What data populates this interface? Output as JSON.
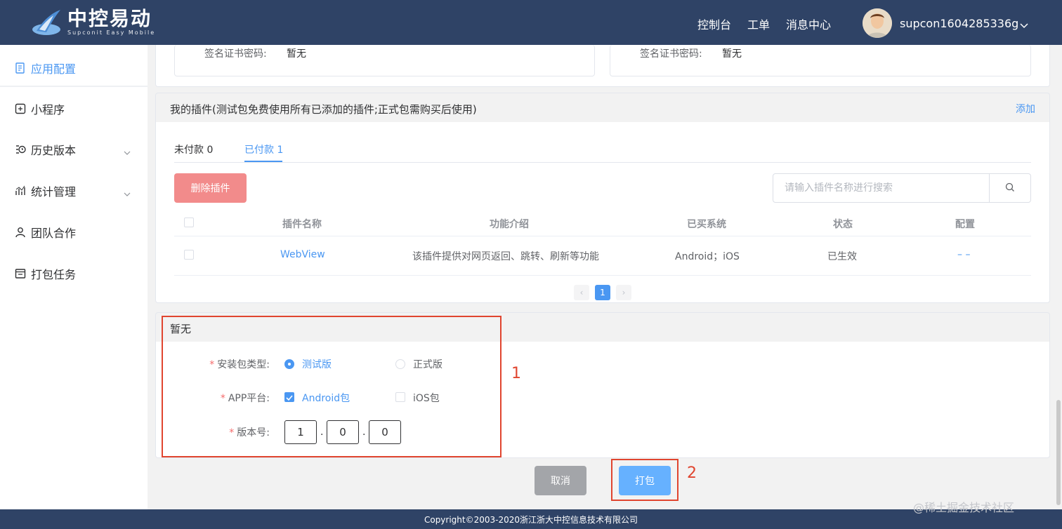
{
  "header": {
    "brand": "中控易动",
    "brand_sub": "Supconit Easy Mobile",
    "nav": [
      "控制台",
      "工单",
      "消息中心"
    ],
    "username": "supcon1604285336g"
  },
  "sidebar": {
    "items": [
      {
        "label": "应用配置",
        "icon": "app-config-icon"
      },
      {
        "label": "小程序",
        "icon": "miniprogram-icon"
      },
      {
        "label": "历史版本",
        "icon": "history-icon"
      },
      {
        "label": "统计管理",
        "icon": "stats-icon"
      },
      {
        "label": "团队合作",
        "icon": "team-icon"
      },
      {
        "label": "打包任务",
        "icon": "task-icon"
      }
    ]
  },
  "signature": {
    "left_label": "签名证书密码:",
    "left_value": "暂无",
    "right_label": "签名证书密码:",
    "right_value": "暂无"
  },
  "plugins": {
    "title": "我的插件(测试包免费使用所有已添加的插件;正式包需购买后使用)",
    "add": "添加",
    "tab_unpaid": "未付款 0",
    "tab_paid": "已付款 1",
    "delete_button": "删除插件",
    "search_placeholder": "请输入插件名称进行搜索",
    "columns": [
      "插件名称",
      "功能介绍",
      "已买系统",
      "状态",
      "配置"
    ],
    "rows": [
      {
        "name": "WebView",
        "desc": "该插件提供对网页返回、跳转、刷新等功能",
        "systems": "Android；iOS",
        "status": "已生效",
        "config": "– –"
      }
    ],
    "page_current": "1",
    "page_prev": "‹",
    "page_next": "›"
  },
  "build": {
    "title": "暂无",
    "package_type_label": "安装包类型:",
    "package_test": "测试版",
    "package_release": "正式版",
    "platform_label": "APP平台:",
    "platform_android": "Android包",
    "platform_ios": "iOS包",
    "version_label": "版本号:",
    "version": [
      "1",
      "0",
      "0"
    ],
    "cancel": "取消",
    "submit": "打包"
  },
  "annotations": {
    "box1": "1",
    "box2": "2"
  },
  "footer": "Copyright©2003-2020浙江浙大中控信息技术有限公司",
  "watermark": "@稀土掘金技术社区",
  "colors": {
    "header": "#2f4366",
    "accent": "#4a97f2",
    "danger": "#f28b8b",
    "annotation": "#e0452f"
  }
}
